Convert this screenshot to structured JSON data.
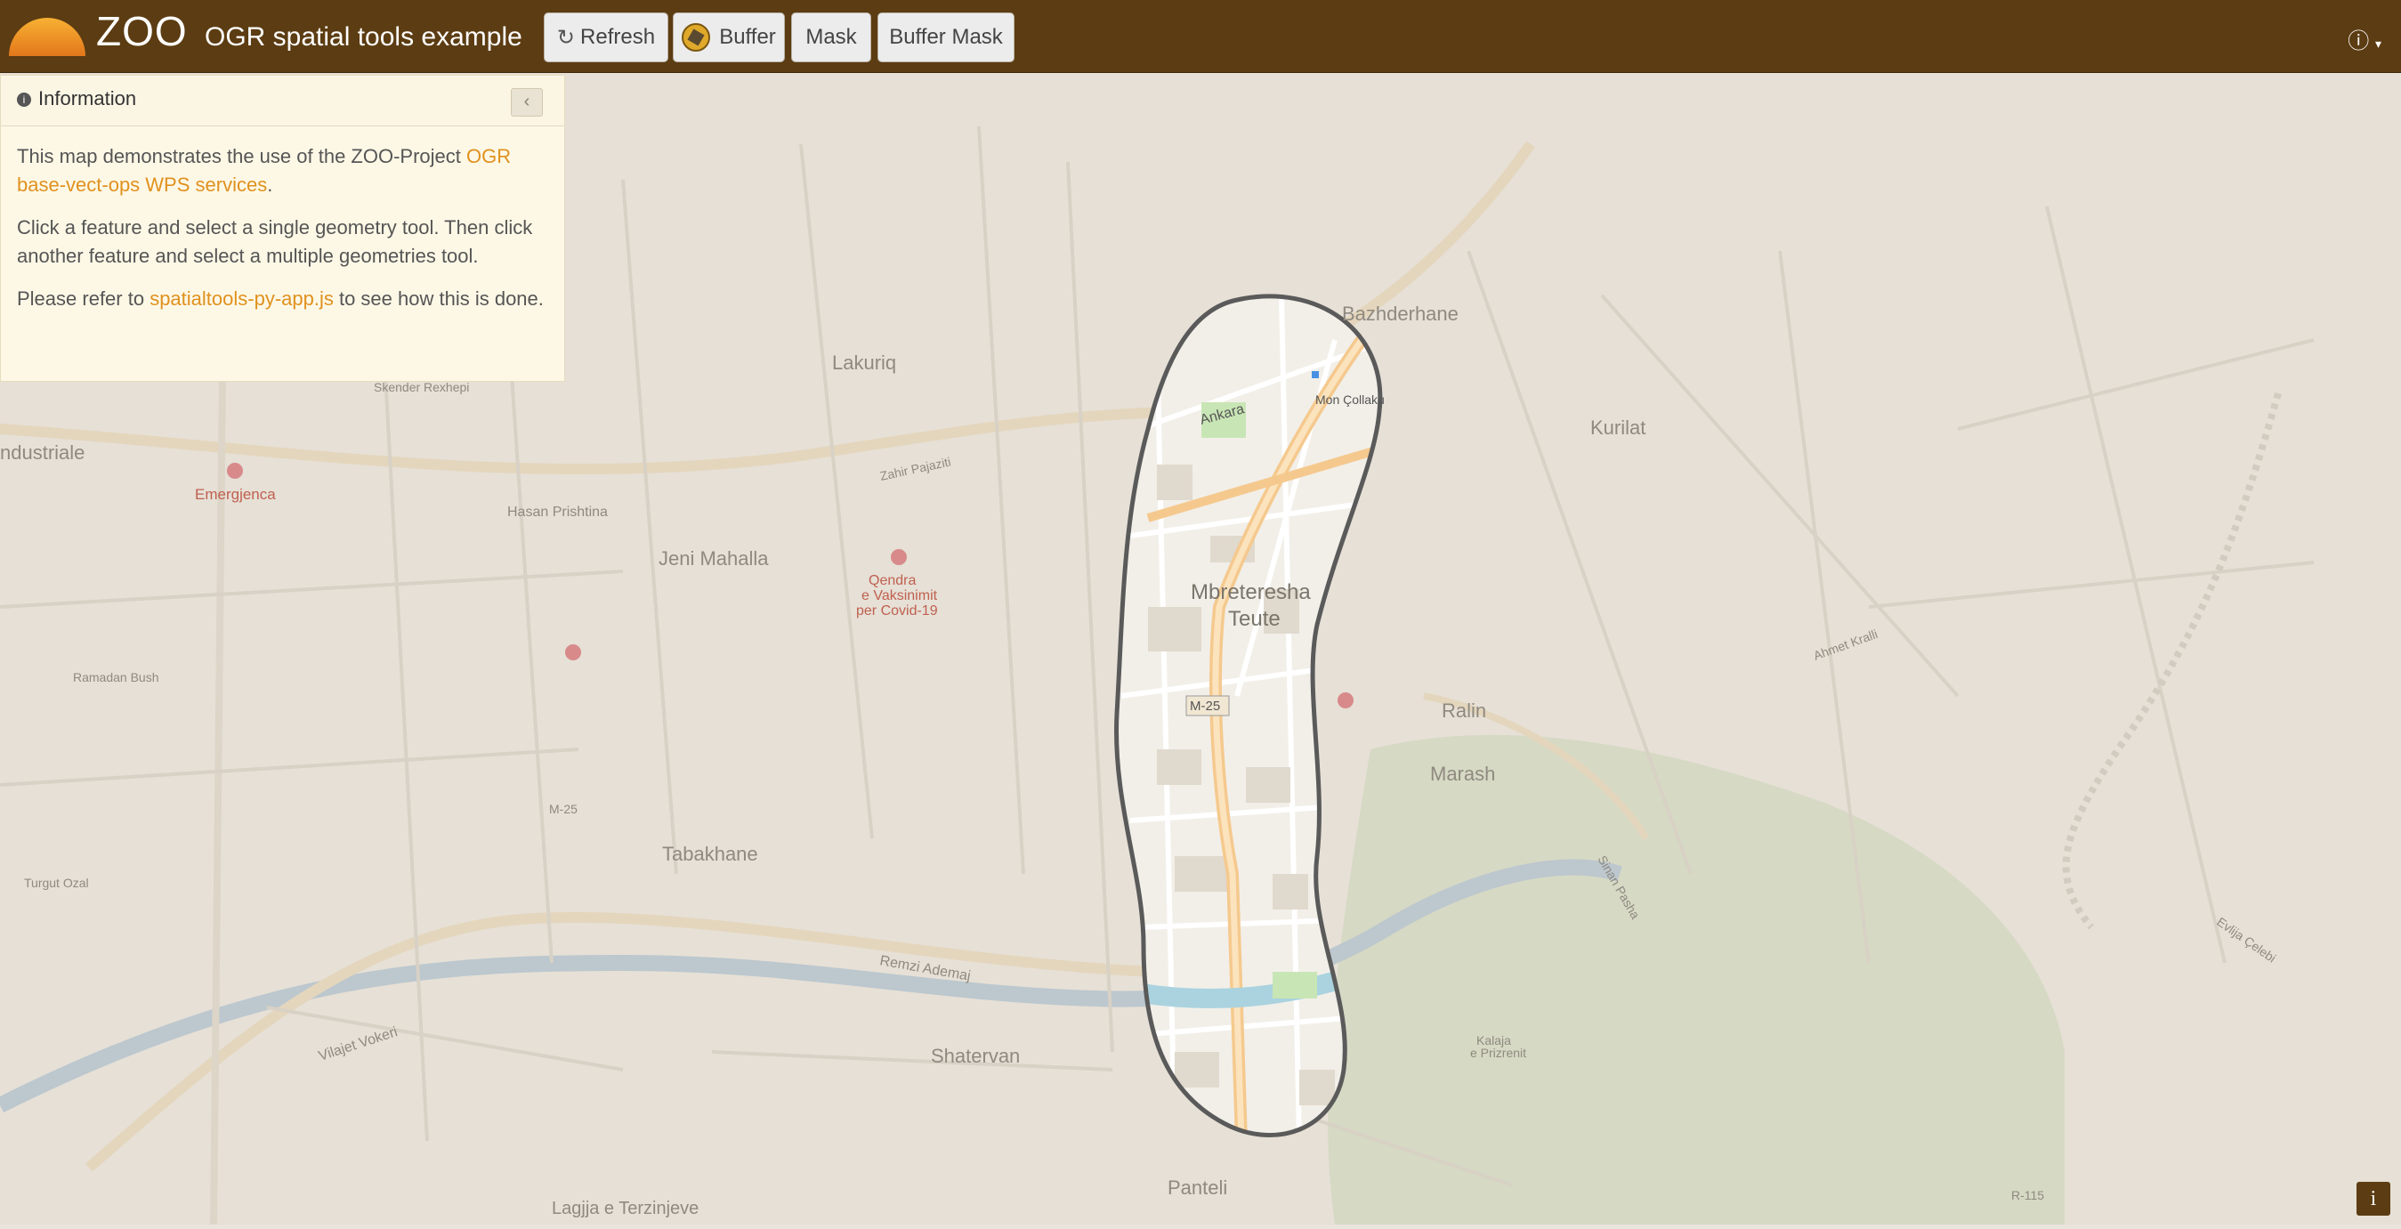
{
  "header": {
    "brand": "ZOO",
    "subtitle": "OGR spatial tools example",
    "buttons": {
      "refresh": "Refresh",
      "buffer": "Buffer",
      "mask": "Mask",
      "buffer_mask": "Buffer Mask"
    }
  },
  "panel": {
    "title": "Information",
    "para1_text": "This map demonstrates the use of the ZOO-Project ",
    "para1_link": "OGR base-vect-ops WPS services",
    "para1_end": ".",
    "para2": "Click a feature and select a single geometry tool. Then click another feature and select a multiple geometries tool.",
    "para3_text": "Please refer to ",
    "para3_link": "spatialtools-py-app.js",
    "para3_end": " to see how this is done."
  },
  "map": {
    "labels": {
      "lakuriq": "Lakuriq",
      "bazhderhane": "Bazhderhane",
      "kurilat": "Kurilat",
      "industriale": "ndustriale",
      "emergjenca": "Emergjenca",
      "jeni_mahalla": "Jeni Mahalla",
      "qendra": "Qendra",
      "qendra2": "e Vaksinimit",
      "qendra3": "per Covid-19",
      "mbreteresha": "Mbreteresha",
      "teute": "Teute",
      "ralin": "Ralin",
      "marash": "Marash",
      "tabakhane": "Tabakhane",
      "shatervan": "Shatervan",
      "panteli": "Panteli",
      "lagjja": "Lagjja e Terzinjeve",
      "kalaja": "Kalaja",
      "prizrenit": "e Prizrenit",
      "hasan_prishtina": "Hasan Prishtina",
      "ramadan_bush": "Ramadan Bush",
      "skender_rexhepi": "Skender Rexhepi",
      "turgut_ozal": "Turgut Ozal",
      "remzi_ademaj": "Remzi Ademaj",
      "vilajet_vokeri": "Vilajet Vokeri",
      "zahir_pajaziti": "Zahir Pajaziti",
      "ankara": "Ankara",
      "mon_colaku": "Mon Çollaku",
      "m25": "M-25",
      "m25b": "M-25",
      "r115": "R-115",
      "evlija_celebi": "Evlija Çelebi",
      "sinan_pasha": "Sinan Pasha",
      "ahmet_kralli": "Ahmet Kralli"
    }
  },
  "attribution": "i",
  "colors": {
    "topbar": "#5c3c12",
    "accent": "#e0911e",
    "panel_bg": "#fdf8e6",
    "buffer_outline": "#5a5a5a"
  }
}
